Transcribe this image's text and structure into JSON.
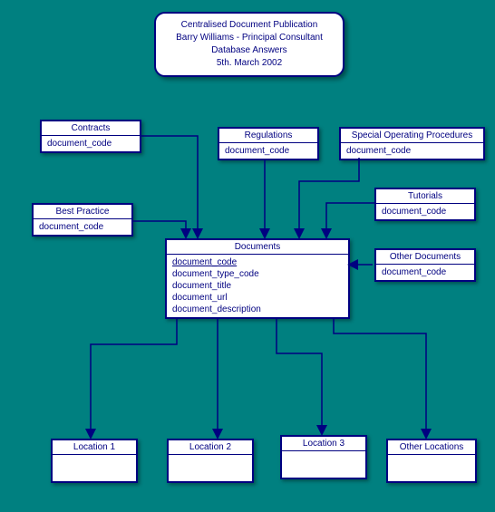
{
  "title": {
    "line1": "Centralised Document Publication",
    "line2": "Barry Williams - Principal Consultant",
    "line3": "Database Answers",
    "line4": "5th. March 2002"
  },
  "entities": {
    "contracts": {
      "name": "Contracts",
      "attrs": [
        "document_code"
      ]
    },
    "regulations": {
      "name": "Regulations",
      "attrs": [
        "document_code"
      ]
    },
    "special": {
      "name": "Special Operating Procedures",
      "attrs": [
        "document_code"
      ]
    },
    "best_practice": {
      "name": "Best Practice",
      "attrs": [
        "document_code"
      ]
    },
    "tutorials": {
      "name": "Tutorials",
      "attrs": [
        "document_code"
      ]
    },
    "other_docs": {
      "name": "Other Documents",
      "attrs": [
        "document_code"
      ]
    },
    "documents": {
      "name": "Documents",
      "pk": "document_code",
      "attrs": [
        "document_type_code",
        "document_title",
        "document_url",
        "document_description"
      ]
    },
    "loc1": {
      "name": "Location 1"
    },
    "loc2": {
      "name": "Location 2"
    },
    "loc3": {
      "name": "Location 3"
    },
    "other_loc": {
      "name": "Other Locations"
    }
  }
}
